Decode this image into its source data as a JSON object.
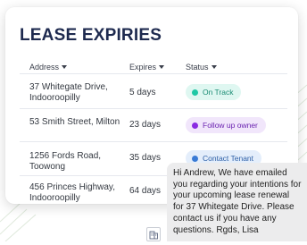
{
  "title": "LEASE EXPIRIES",
  "columns": {
    "address": "Address",
    "expires": "Expires",
    "status": "Status"
  },
  "rows": [
    {
      "address": "37 Whitegate Drive, Indooroopilly",
      "expires": "5 days",
      "status": "On Track",
      "status_color": "#1ec8a5",
      "badge_bg": "#dff7f1",
      "badge_text": "#1b8c74"
    },
    {
      "address": "53 Smith Street, Milton",
      "expires": "23 days",
      "status": "Follow up owner",
      "status_color": "#8a2be2",
      "badge_bg": "#f1e6fb",
      "badge_text": "#6a22b0"
    },
    {
      "address": "1256 Fords Road, Toowong",
      "expires": "35 days",
      "status": "Contact Tenant",
      "status_color": "#3a7bd5",
      "badge_bg": "#e4eefb",
      "badge_text": "#2d5fa6"
    },
    {
      "address": "456 Princes Highway, Indooroopilly",
      "expires": "64 days",
      "status": "",
      "status_color": "",
      "badge_bg": "",
      "badge_text": ""
    }
  ],
  "message": "Hi Andrew, We have emailed you regarding your intentions for your upcoming lease renewal for 37 Whitegate Drive. Please contact us if you have any questions. Rgds, Lisa",
  "icons": {
    "avatar": "building-avatar-icon",
    "caret": "caret-down-icon"
  }
}
